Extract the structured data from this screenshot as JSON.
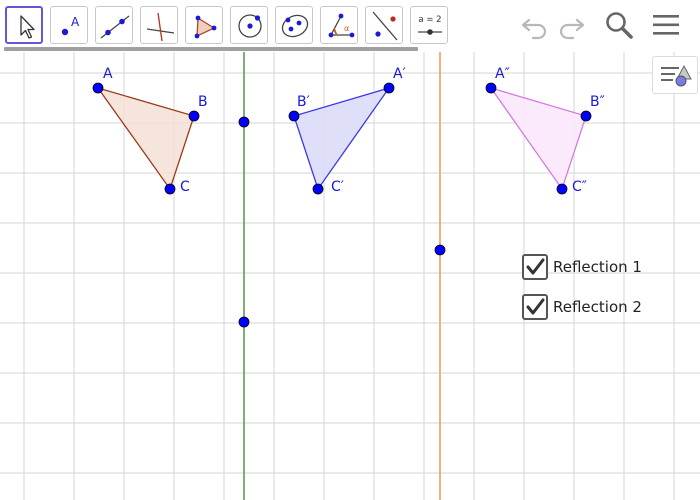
{
  "toolbar": {
    "tools": [
      {
        "name": "move-tool",
        "selected": true
      },
      {
        "name": "point-tool",
        "icon_text": "A"
      },
      {
        "name": "line-tool"
      },
      {
        "name": "perpendicular-line-tool"
      },
      {
        "name": "polygon-tool"
      },
      {
        "name": "circle-tool"
      },
      {
        "name": "conic-tool"
      },
      {
        "name": "angle-tool"
      },
      {
        "name": "reflect-tool"
      },
      {
        "name": "slider-tool",
        "icon_text": "a = 2"
      }
    ],
    "actions": [
      "undo-icon",
      "redo-icon",
      "search-icon",
      "menu-icon"
    ]
  },
  "canvas": {
    "colors": {
      "grid": "#d6d6d6",
      "point": "#0000ff",
      "mirror_line_1": "#5a9b5a",
      "mirror_line_2": "#f2a05a",
      "triangle_abc_stroke": "#9b3a1a",
      "triangle_abc_fill": "#f3e0d7",
      "triangle_a1_stroke": "#3a3adf",
      "triangle_a1_fill": "#dcdcfa",
      "triangle_a2_stroke": "#d57be0",
      "triangle_a2_fill": "#fbe8fc",
      "label": "#1a1ad8"
    },
    "triangles": [
      {
        "id": "ABC",
        "labels": [
          "A",
          "B",
          "C"
        ]
      },
      {
        "id": "A1B1C1",
        "labels": [
          "A′",
          "B′",
          "C′"
        ]
      },
      {
        "id": "A2B2C2",
        "labels": [
          "A″",
          "B″",
          "C″"
        ]
      }
    ]
  },
  "checkboxes": [
    {
      "label": "Reflection 1",
      "checked": true
    },
    {
      "label": "Reflection 2",
      "checked": true
    }
  ]
}
